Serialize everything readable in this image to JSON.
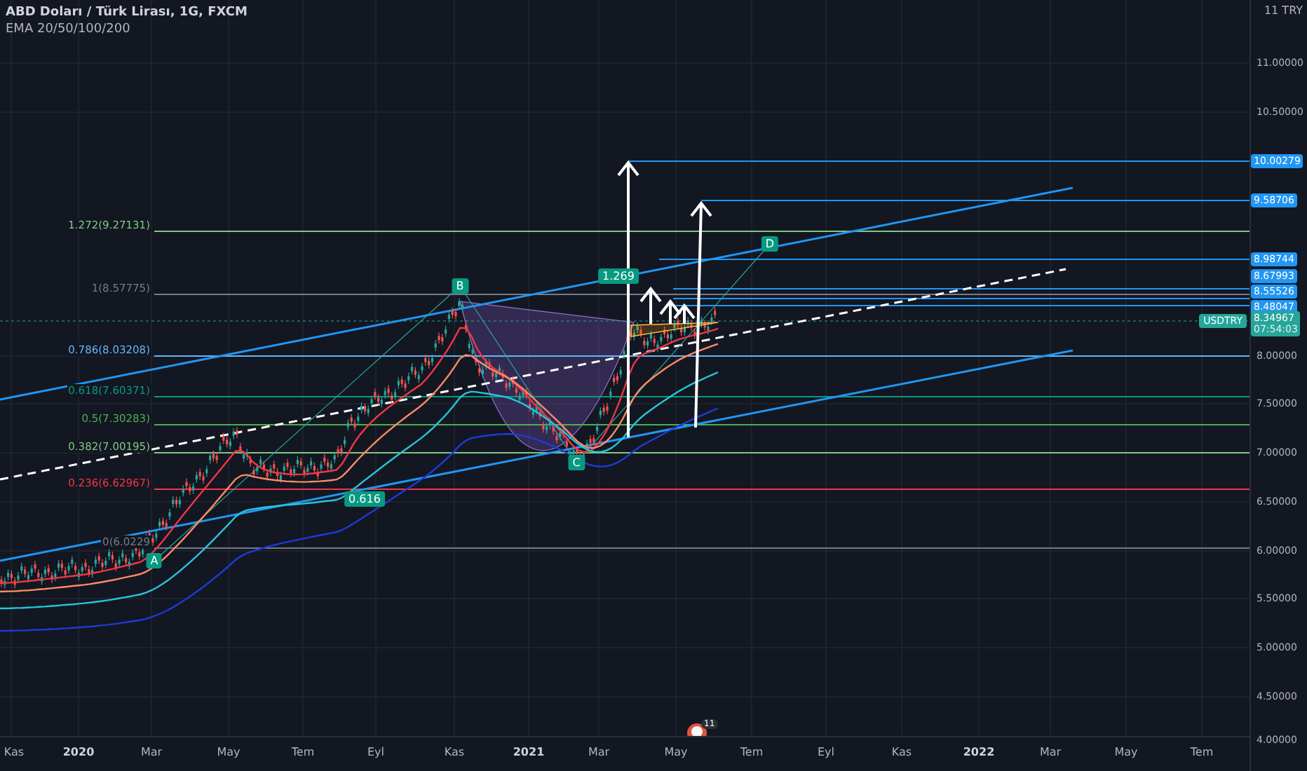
{
  "header": {
    "title": "ABD Doları / Türk Lirası, 1G, FXCM",
    "indicator": "EMA 20/50/100/200"
  },
  "price_axis": {
    "unit": "11 TRY",
    "labels": [
      "11.00000",
      "10.50000",
      "8.00000",
      "7.50000",
      "7.00000",
      "6.50000",
      "6.00000",
      "5.50000",
      "5.00000",
      "4.50000",
      "4.00000"
    ]
  },
  "price_tags": [
    {
      "kind": "level",
      "value": "10.00279"
    },
    {
      "kind": "level",
      "value": "9.58706"
    },
    {
      "kind": "level",
      "value": "8.98744"
    },
    {
      "kind": "level",
      "value": "8.67993"
    },
    {
      "kind": "level",
      "value": "8.55526"
    },
    {
      "kind": "level",
      "value": "8.48047"
    },
    {
      "kind": "last",
      "symbol": "USDTRY",
      "value": "8.34967",
      "time": "07:54:03"
    }
  ],
  "fib_levels": [
    {
      "label": "1.272(9.27131)",
      "color": "#81c784"
    },
    {
      "label": "1(8.57775)",
      "color": "#787b86"
    },
    {
      "label": "0.786(8.03208)",
      "color": "#64b5f6"
    },
    {
      "label": "0.618(7.60371)",
      "color": "#089981"
    },
    {
      "label": "0.5(7.30283)",
      "color": "#4caf50"
    },
    {
      "label": "0.382(7.00195)",
      "color": "#81c784"
    },
    {
      "label": "0.236(6.62967)",
      "color": "#f23645"
    },
    {
      "label": "0(6.0229",
      "color": "#787b86"
    }
  ],
  "pattern_points": [
    "A",
    "B",
    "C",
    "D"
  ],
  "ratio_labels": [
    "1.269",
    "0.616"
  ],
  "event_badge": {
    "count": "11"
  },
  "time_axis": [
    {
      "label": "Kas",
      "kind": "month"
    },
    {
      "label": "2020",
      "kind": "year"
    },
    {
      "label": "Mar",
      "kind": "month"
    },
    {
      "label": "May",
      "kind": "month"
    },
    {
      "label": "Tem",
      "kind": "month"
    },
    {
      "label": "Eyl",
      "kind": "month"
    },
    {
      "label": "Kas",
      "kind": "month"
    },
    {
      "label": "2021",
      "kind": "year"
    },
    {
      "label": "Mar",
      "kind": "month"
    },
    {
      "label": "May",
      "kind": "month"
    },
    {
      "label": "Tem",
      "kind": "month"
    },
    {
      "label": "Eyl",
      "kind": "month"
    },
    {
      "label": "Kas",
      "kind": "month"
    },
    {
      "label": "2022",
      "kind": "year"
    },
    {
      "label": "Mar",
      "kind": "month"
    },
    {
      "label": "May",
      "kind": "month"
    },
    {
      "label": "Tem",
      "kind": "month"
    }
  ]
}
